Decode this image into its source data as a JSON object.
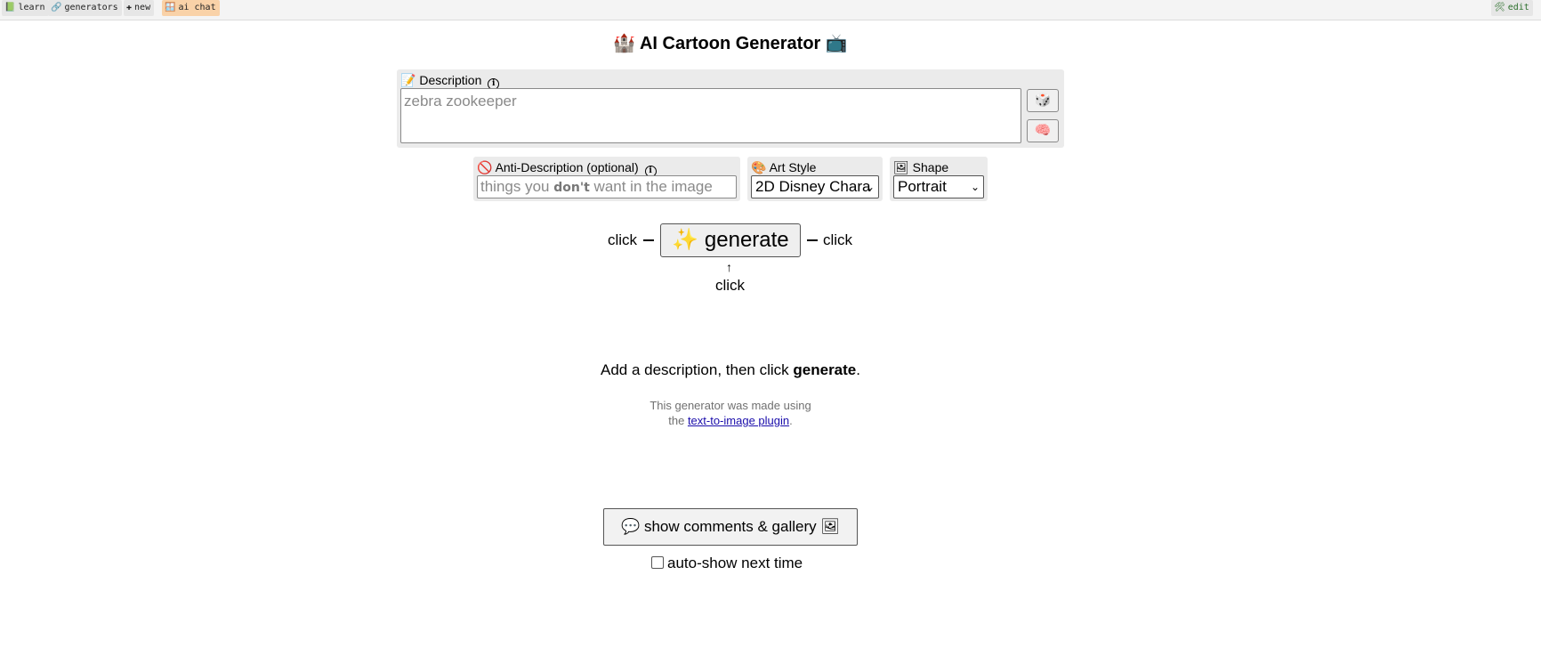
{
  "nav": {
    "learn": "learn",
    "generators": "generators",
    "new": "new",
    "ai_chat": "ai chat",
    "edit": "edit"
  },
  "title": "AI Cartoon Generator",
  "description": {
    "label": "Description",
    "placeholder": "zebra zookeeper"
  },
  "anti": {
    "label": "Anti-Description (optional)",
    "placeholder_pre": "things you ",
    "placeholder_bold": "don't",
    "placeholder_post": " want in the image"
  },
  "art_style": {
    "label": "Art Style",
    "value": "2D Disney Chara"
  },
  "shape": {
    "label": "Shape",
    "value": "Portrait"
  },
  "generate": {
    "label": "generate",
    "click_left": "click",
    "click_right": "click",
    "click_below": "click"
  },
  "hint": {
    "pre": "Add a description, then click ",
    "bold": "generate",
    "post": "."
  },
  "made_with": {
    "line1": "This generator was made using",
    "line2_pre": "the ",
    "link": "text-to-image plugin",
    "line2_post": "."
  },
  "comments": {
    "button": "show comments & gallery",
    "auto_show": "auto-show next time"
  },
  "colors": {
    "panel_bg": "#ebebeb",
    "ai_chat_bg": "#f9d2a8",
    "link": "#1a0dab"
  }
}
